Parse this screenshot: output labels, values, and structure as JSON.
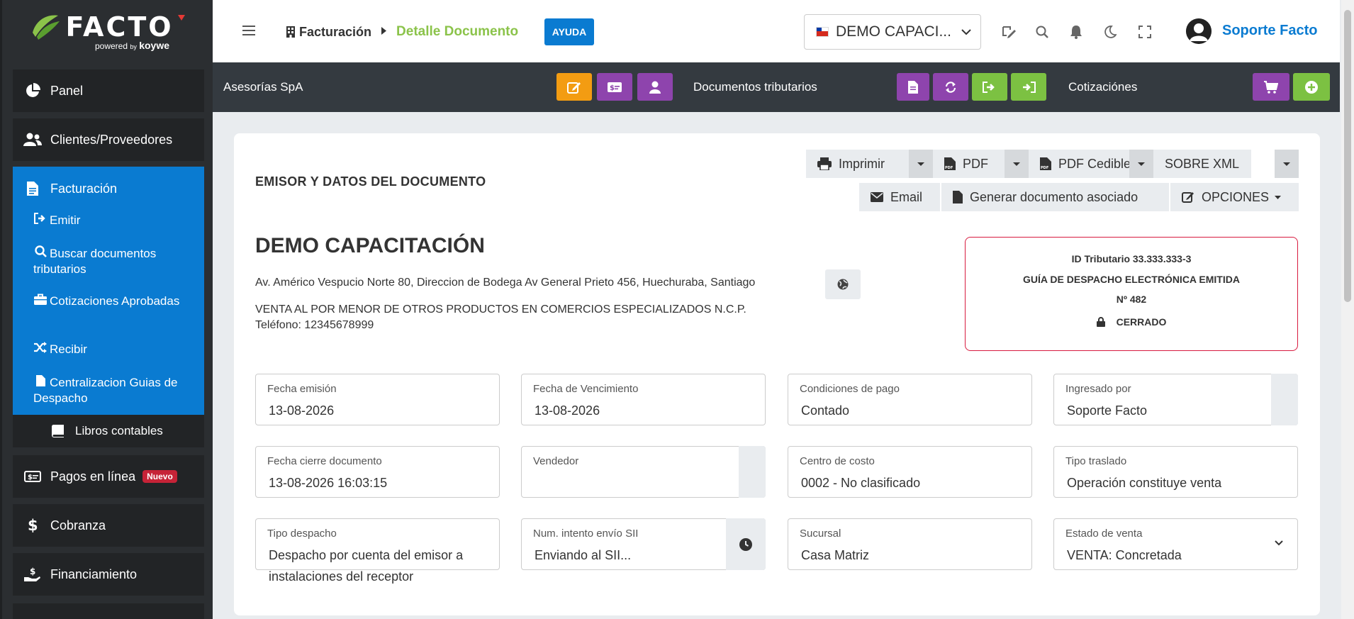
{
  "sidebar": {
    "logo": {
      "name": "FACTO",
      "sub_powered": "powered",
      "sub_by": "by",
      "sub_brand": "koywe"
    },
    "items": [
      {
        "label": "Panel"
      },
      {
        "label": "Clientes/Proveedores"
      },
      {
        "label": "Facturación"
      },
      {
        "label": "Pagos en línea"
      },
      {
        "label": "Cobranza"
      },
      {
        "label": "Financiamiento"
      }
    ],
    "sub_items": [
      {
        "label": "Emitir"
      },
      {
        "label": "Buscar documentos tributarios"
      },
      {
        "label": "Cotizaciones Aprobadas"
      },
      {
        "label": "Recibir"
      },
      {
        "label": "Centralizacion Guias de Despacho"
      },
      {
        "label": "Libros contables"
      }
    ],
    "new_badge": "Nuevo"
  },
  "header": {
    "breadcrumb_root": "Facturación",
    "breadcrumb_current": "Detalle Documento",
    "help_label": "AYUDA",
    "company_select": "DEMO CAPACI...",
    "user_name": "Soporte Facto"
  },
  "toolbar": {
    "client_label": "Asesorías SpA",
    "docs_label": "Documentos tributarios",
    "quotes_label": "Cotizaciónes"
  },
  "actions": {
    "print": "Imprimir",
    "pdf": "PDF",
    "pdf_cedible": "PDF Cedible",
    "sobre_xml": "SOBRE XML",
    "email": "Email",
    "generate_assoc": "Generar documento asociado",
    "options": "OPCIONES"
  },
  "document": {
    "section_title": "EMISOR Y DATOS DEL DOCUMENTO",
    "company": "DEMO CAPACITACIÓN",
    "address": "Av. Américo Vespucio Norte 80, Direccion de Bodega Av General Prieto 456, Huechuraba, Santiago",
    "giro": "VENTA AL POR MENOR DE OTROS PRODUCTOS EN COMERCIOS ESPECIALIZADOS N.C.P.",
    "phone": "Teléfono: 12345678999",
    "tax_id": "ID Tributario 33.333.333-3",
    "doc_type": "GUÍA DE DESPACHO ELECTRÓNICA EMITIDA",
    "doc_number": "Nº 482",
    "status": "CERRADO"
  },
  "fields": [
    {
      "label": "Fecha emisión",
      "value": "13-08-2026"
    },
    {
      "label": "Fecha de Vencimiento",
      "value": "13-08-2026"
    },
    {
      "label": "Condiciones de pago",
      "value": "Contado"
    },
    {
      "label": "Ingresado por",
      "value": "Soporte Facto"
    },
    {
      "label": "Fecha cierre documento",
      "value": "13-08-2026 16:03:15"
    },
    {
      "label": "Vendedor",
      "value": ""
    },
    {
      "label": "Centro de costo",
      "value": "0002 - No clasificado"
    },
    {
      "label": "Tipo traslado",
      "value": "Operación constituye venta"
    },
    {
      "label": "Tipo despacho",
      "value": "Despacho por cuenta del emisor a instalaciones del receptor"
    },
    {
      "label": "Num. intento envío SII",
      "value": "Enviando al SII..."
    },
    {
      "label": "Sucursal",
      "value": "Casa Matriz"
    },
    {
      "label": "Estado de venta",
      "value": "VENTA: Concretada"
    }
  ],
  "colors": {
    "primary": "#0a7bd1",
    "accent_green": "#8bc34a",
    "orange": "#f39c12",
    "purple": "#8e44ad",
    "danger": "#d81b3f"
  }
}
